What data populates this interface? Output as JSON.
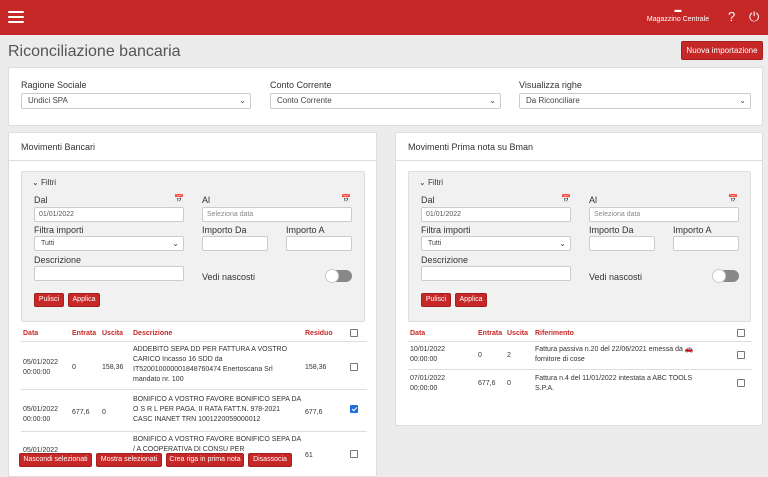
{
  "topbar": {
    "warehouse_icon": "warehouse-icon",
    "warehouse": "Magazzino Centrale",
    "help_icon": "?",
    "power_icon": "⏻"
  },
  "page": {
    "title": "Riconciliazione bancaria",
    "new_import": "Nuova importazione"
  },
  "filters": {
    "company_label": "Ragione Sociale",
    "company_value": "Undici SPA",
    "account_label": "Conto Corrente",
    "account_value": "Conto Corrente",
    "rows_label": "Visualizza righe",
    "rows_value": "Da Riconciliare"
  },
  "left": {
    "title": "Movimenti Bancari",
    "filtri": "Filtri",
    "dal_label": "Dal",
    "dal_value": "01/01/2022",
    "al_label": "Al",
    "al_placeholder": "Seleziona data",
    "filtro_label": "Filtra importi",
    "filtro_value": "Tutti",
    "importo_da": "Importo Da",
    "importo_a": "Importo A",
    "descrizione": "Descrizione",
    "vedi": "Vedi nascosti",
    "pulisci": "Pulisci",
    "applica": "Applica",
    "cols": [
      "Data",
      "Entrata",
      "Uscita",
      "Descrizione",
      "Residuo"
    ],
    "rows": [
      {
        "data": "05/01/2022 00:00:00",
        "entrata": "0",
        "uscita": "158,36",
        "descr": "ADDEBITO SEPA DD PER FATTURA A VOSTRO CARICO Incasso 16 SDD da IT520010000001848760474 Enertoscana Srl mandato nr. 100",
        "residuo": "158,36",
        "checked": false
      },
      {
        "data": "05/01/2022 00:00:00",
        "entrata": "677,6",
        "uscita": "0",
        "descr": "BONIFICO A VOSTRO FAVORE BONIFICO SEPA DA O S R L PER PAGA. II RATA FATT.N. 978-2021 CASC INANET TRN 1001220059000012",
        "residuo": "677,6",
        "checked": true
      },
      {
        "data": "05/01/2022",
        "entrata": "",
        "uscita": "",
        "descr": "BONIFICO A VOSTRO FAVORE BONIFICO SEPA DA / A COOPERATIVA DI CONSU PER",
        "residuo": "61",
        "checked": false
      }
    ],
    "actions": [
      "Nascondi selezionati",
      "Mostra selezionati",
      "Crea riga in prima nota",
      "Disassocia"
    ]
  },
  "right": {
    "title": "Movimenti Prima nota su Bman",
    "filtri": "Filtri",
    "dal_label": "Dal",
    "dal_value": "01/01/2022",
    "al_label": "Al",
    "al_placeholder": "Seleziona data",
    "filtro_label": "Filtra importi",
    "filtro_value": "Tutti",
    "importo_da": "Importo Da",
    "importo_a": "Importo A",
    "descrizione": "Descrizione",
    "vedi": "Vedi nascosti",
    "pulisci": "Pulisci",
    "applica": "Applica",
    "cols": [
      "Data",
      "Entrata",
      "Uscita",
      "Riferimento"
    ],
    "rows": [
      {
        "data": "10/01/2022 00:00:00",
        "entrata": "0",
        "uscita": "2",
        "rif": "Fattura passiva n.20 del 22/06/2021 emessa da 🚗 fornitore di cose",
        "checked": false
      },
      {
        "data": "07/01/2022 00:00:00",
        "entrata": "677,6",
        "uscita": "0",
        "rif": "Fattura n.4 del 11/01/2022 intestata a ABC TOOLS S.P.A.",
        "checked": false
      }
    ]
  },
  "colors": {
    "accent": "#c62828",
    "checkbox_on": "#1e6fd9"
  }
}
